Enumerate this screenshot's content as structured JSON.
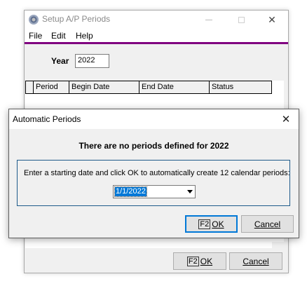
{
  "main_window": {
    "title": "Setup A/P Periods",
    "menu": [
      "File",
      "Edit",
      "Help"
    ],
    "year_label": "Year",
    "year_value": "2022",
    "grid_headers": [
      "Period",
      "Begin Date",
      "End Date",
      "Status"
    ],
    "ok_fkey": "F2",
    "ok_label": "OK",
    "cancel_label": "Cancel",
    "accent_color": "#800080"
  },
  "dialog": {
    "title": "Automatic Periods",
    "headline": "There are no periods defined for 2022",
    "instruction": "Enter a starting date and click OK to automatically create 12 calendar periods:",
    "date_value": "1/1/2022",
    "ok_fkey": "F2",
    "ok_label": "OK",
    "cancel_label": "Cancel",
    "focus_color": "#0078d7"
  },
  "icons": {
    "app": "gear-icon",
    "close": "close-icon",
    "minimize": "minimize-icon",
    "maximize": "maximize-icon",
    "dropdown": "chevron-down-icon"
  }
}
